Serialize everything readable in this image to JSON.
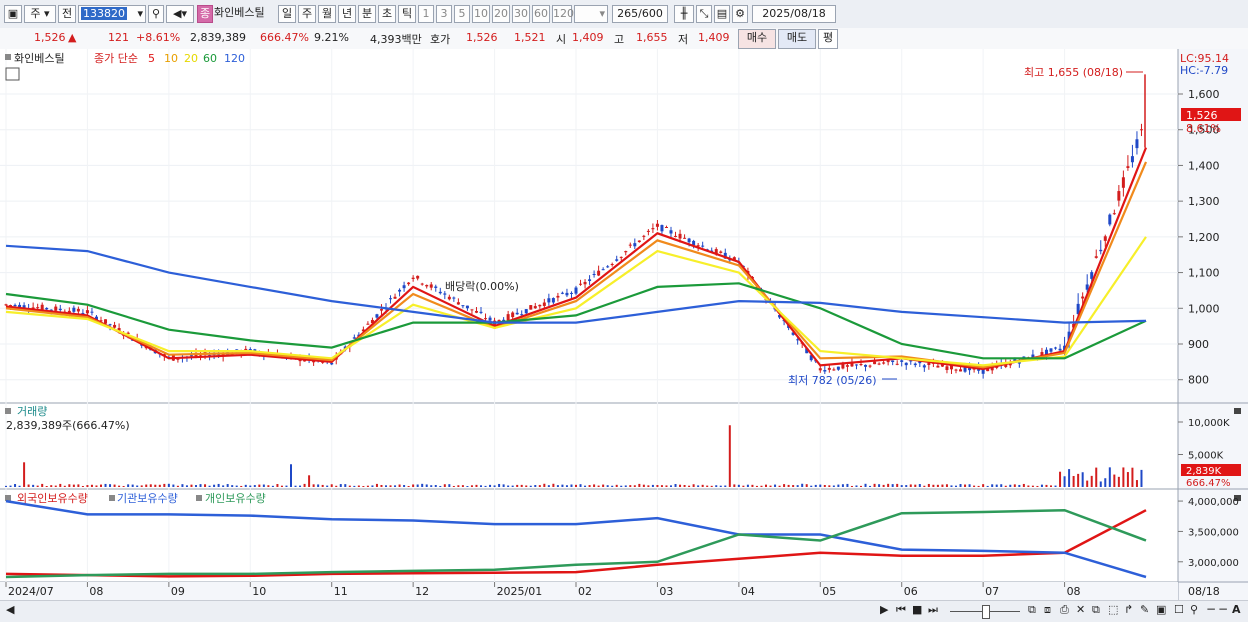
{
  "toolbar": {
    "type_select": "주",
    "prev_label": "전",
    "code_value": "133820",
    "badge_label": "종",
    "stock_name": "화인베스틸",
    "periods": [
      "일",
      "주",
      "월",
      "년",
      "분",
      "초",
      "틱"
    ],
    "active_period": "일",
    "intervals": [
      "1",
      "3",
      "5",
      "10",
      "20",
      "30",
      "60",
      "120"
    ],
    "count_value": "265",
    "count_total": "/600",
    "date_value": "2025/08/18"
  },
  "infobar": {
    "price": "1,526",
    "change_arrow": "▲",
    "change": "121",
    "change_pct": "+8.61%",
    "volume": "2,839,389",
    "volume_ratio": "666.47%",
    "turnover": "9.21%",
    "amount": "4,393백만",
    "quote_label": "호가",
    "ask": "1,526",
    "bid": "1,521",
    "open_label": "시",
    "open": "1,409",
    "high_label": "고",
    "high": "1,655",
    "low_label": "저",
    "low": "1,409",
    "buy_label": "매수",
    "sell_label": "매도",
    "eval_label": "평"
  },
  "price_panel": {
    "legend_name": "화인베스틸",
    "legend_ma": "종가 단순",
    "ma_periods": [
      "5",
      "10",
      "20",
      "60",
      "120"
    ],
    "lc_label": "LC:95.14",
    "hc_label": "HC:-7.79",
    "high_annotation": "최고 1,655 (08/18)",
    "low_annotation": "최저 782 (05/26)",
    "dividend_label": "배당락(0.00%)",
    "current_tag": "1,526",
    "current_pct": "8.61%",
    "y_ticks": [
      "1,600",
      "1,500",
      "1,400",
      "1,300",
      "1,200",
      "1,100",
      "1,000",
      "900",
      "800"
    ]
  },
  "volume_panel": {
    "title": "거래량",
    "value_text": "2,839,389주(666.47%)",
    "y_ticks": [
      "10,000K",
      "5,000K"
    ],
    "current_tag": "2,839K",
    "current_pct": "666.47%"
  },
  "holdings_panel": {
    "legend": [
      "외국인보유수량",
      "기관보유수량",
      "개인보유수량"
    ],
    "y_ticks": [
      "4,000,000",
      "3,500,000",
      "3,000,000"
    ]
  },
  "x_axis": {
    "labels": [
      "2024/07",
      "08",
      "09",
      "10",
      "11",
      "12",
      "2025/01",
      "02",
      "03",
      "04",
      "05",
      "06",
      "07",
      "08"
    ],
    "end_label": "08/18"
  },
  "colors": {
    "up": "#d31d1d",
    "down": "#1f48c7",
    "ma5": "#e01515",
    "ma10": "#f08a1c",
    "ma20": "#f7ef2a",
    "ma60": "#1b9a3a",
    "ma120": "#2d5fd8",
    "foreign": "#e01515",
    "institution": "#2d5fd8",
    "individual": "#2e9a5a"
  },
  "chart_data": {
    "type": "line",
    "title": "화인베스틸",
    "ylim": [
      760,
      1670
    ],
    "x": [
      "2024/07",
      "08",
      "09",
      "10",
      "11",
      "12",
      "2025/01",
      "02",
      "03",
      "04",
      "05",
      "06",
      "07",
      "08",
      "08/18"
    ],
    "series": [
      {
        "name": "종가",
        "values": [
          1010,
          990,
          860,
          880,
          845,
          1090,
          960,
          1050,
          1230,
          1130,
          830,
          850,
          825,
          890,
          1526
        ]
      },
      {
        "name": "5",
        "values": [
          1005,
          980,
          860,
          870,
          850,
          1060,
          950,
          1030,
          1210,
          1130,
          840,
          860,
          830,
          880,
          1450
        ]
      },
      {
        "name": "10",
        "values": [
          1000,
          975,
          870,
          875,
          855,
          1040,
          945,
          1020,
          1190,
          1120,
          860,
          865,
          835,
          875,
          1410
        ]
      },
      {
        "name": "20",
        "values": [
          990,
          970,
          880,
          880,
          860,
          1010,
          945,
          1000,
          1160,
          1100,
          880,
          860,
          840,
          865,
          1200
        ]
      },
      {
        "name": "60",
        "values": [
          1040,
          1010,
          940,
          910,
          890,
          960,
          960,
          980,
          1060,
          1070,
          1000,
          900,
          860,
          860,
          965
        ]
      },
      {
        "name": "120",
        "values": [
          1175,
          1160,
          1100,
          1060,
          1020,
          990,
          960,
          960,
          990,
          1020,
          1015,
          990,
          975,
          960,
          965
        ]
      }
    ],
    "highlights": {
      "high": 1655,
      "high_date": "08/18",
      "low": 782,
      "low_date": "05/26"
    },
    "volume": {
      "current": 2839389,
      "ratio_pct": 666.47
    },
    "holdings": {
      "x": [
        "2024/07",
        "08",
        "09",
        "10",
        "11",
        "12",
        "2025/01",
        "02",
        "03",
        "04",
        "05",
        "06",
        "07",
        "08",
        "08/18"
      ],
      "외국인보유수량": [
        2800000,
        2780000,
        2760000,
        2770000,
        2800000,
        2810000,
        2820000,
        2830000,
        2950000,
        3050000,
        3150000,
        3100000,
        3100000,
        3150000,
        3850000
      ],
      "기관보유수량": [
        4000000,
        3780000,
        3780000,
        3760000,
        3700000,
        3680000,
        3620000,
        3620000,
        3720000,
        3450000,
        3450000,
        3200000,
        3180000,
        3150000,
        2750000
      ],
      "개인보유수량": [
        2750000,
        2780000,
        2800000,
        2800000,
        2830000,
        2850000,
        2870000,
        2950000,
        3000000,
        3450000,
        3350000,
        3800000,
        3820000,
        3850000,
        3350000
      ]
    }
  }
}
